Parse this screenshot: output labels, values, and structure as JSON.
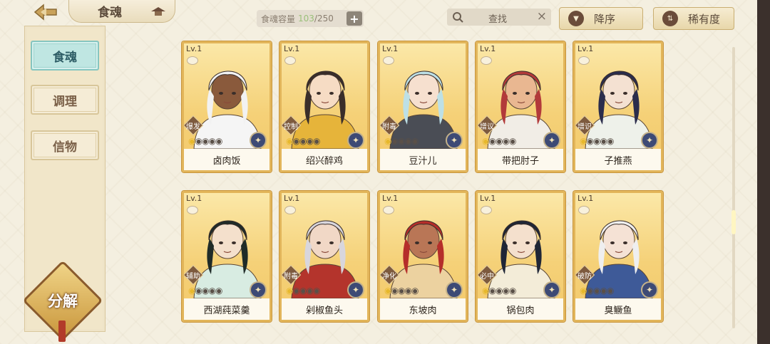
{
  "header": {
    "back_label": "",
    "title": "食魂",
    "capacity_label": "食魂容量",
    "capacity_current": "103",
    "capacity_max": "/250",
    "add_label": "+",
    "search_placeholder": "查找",
    "sort_order_label": "降序",
    "sort_key_label": "稀有度"
  },
  "sidebar": {
    "items": [
      {
        "label": "食魂",
        "active": true
      },
      {
        "label": "调理",
        "active": false
      },
      {
        "label": "信物",
        "active": false
      }
    ],
    "decompose_label": "分解"
  },
  "cards": [
    {
      "level": "Lv.1",
      "role": "爆发",
      "name": "卤肉饭",
      "stars_filled": 1,
      "hair": "#f2f2f2",
      "skin": "#8a5a3c",
      "cloth": "#f5f5f5"
    },
    {
      "level": "Lv.1",
      "role": "控制",
      "name": "绍兴醉鸡",
      "stars_filled": 1,
      "hair": "#3a2e2a",
      "skin": "#f6dcc4",
      "cloth": "#e6b43a"
    },
    {
      "level": "Lv.1",
      "role": "附毒",
      "name": "豆汁儿",
      "stars_filled": 1,
      "hair": "#bde0e6",
      "skin": "#f6e0cf",
      "cloth": "#4a4d55"
    },
    {
      "level": "Lv.1",
      "role": "增议",
      "name": "带把肘子",
      "stars_filled": 1,
      "hair": "#b23a3a",
      "skin": "#e9b791",
      "cloth": "#f1ede6"
    },
    {
      "level": "Lv.1",
      "role": "增识",
      "name": "子推燕",
      "stars_filled": 1,
      "hair": "#2b2d4c",
      "skin": "#f4e1d2",
      "cloth": "#eef1ea"
    },
    {
      "level": "Lv.1",
      "role": "辅助",
      "name": "西湖莼菜羹",
      "stars_filled": 1,
      "hair": "#1f2b28",
      "skin": "#f4e0cc",
      "cloth": "#d8ece2"
    },
    {
      "level": "Lv.1",
      "role": "附毒",
      "name": "剁椒鱼头",
      "stars_filled": 1,
      "hair": "#d8d6dd",
      "skin": "#f1d8c6",
      "cloth": "#b4342c"
    },
    {
      "level": "Lv.1",
      "role": "净化",
      "name": "东坡肉",
      "stars_filled": 1,
      "hair": "#b52e2a",
      "skin": "#b97656",
      "cloth": "#ecd2a0"
    },
    {
      "level": "Lv.1",
      "role": "必中",
      "name": "锅包肉",
      "stars_filled": 1,
      "hair": "#1f2636",
      "skin": "#f4e0cd",
      "cloth": "#f3ecd8"
    },
    {
      "level": "Lv.1",
      "role": "破防",
      "name": "臭鳜鱼",
      "stars_filled": 1,
      "hair": "#efefef",
      "skin": "#f5e2d5",
      "cloth": "#3e5a98"
    }
  ]
}
